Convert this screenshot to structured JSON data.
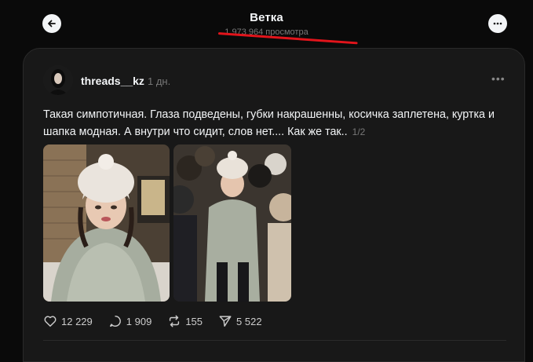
{
  "header": {
    "title": "Ветка",
    "views": "1 973 964 просмотра",
    "back_icon": "arrow-left-icon",
    "more_icon": "more-horizontal-icon"
  },
  "post": {
    "username": "threads__kz",
    "time": "1 дн.",
    "text": "Такая симпотичная. Глаза подведены, губки накрашенны, косичка заплетена, куртка и шапка модная. А внутри что сидит, слов нет.... Как же так..",
    "counter": "1/2",
    "more_label": "•••"
  },
  "actions": {
    "likes": "12 229",
    "replies": "1 909",
    "reposts": "155",
    "shares": "5 522"
  },
  "colors": {
    "background": "#0a0a0a",
    "card": "#181818",
    "annotation_red": "#e2141b"
  }
}
